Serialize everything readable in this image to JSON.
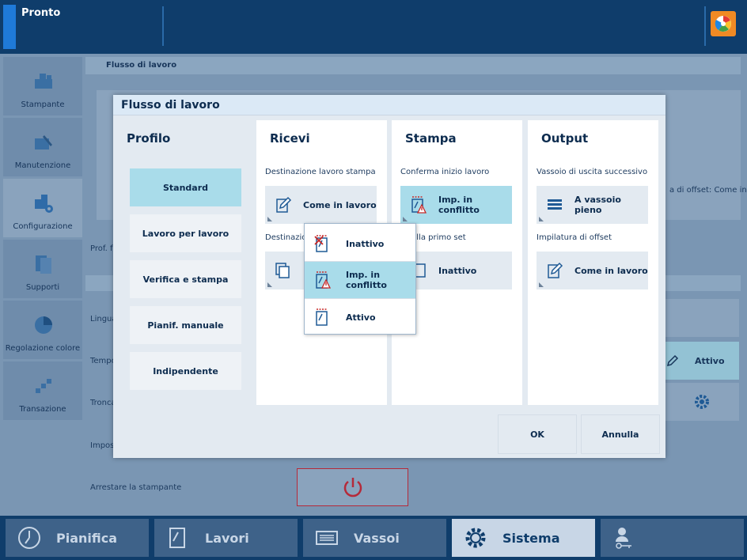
{
  "status": {
    "text": "Pronto"
  },
  "colors": {
    "accent": "#1f7ad8",
    "highlight": "#a9dcea",
    "stop": "#b52a3a"
  },
  "left_nav": [
    {
      "label": "Stampante",
      "icon": "printer-icon"
    },
    {
      "label": "Manutenzione",
      "icon": "maintenance-icon"
    },
    {
      "label": "Configurazione",
      "icon": "configuration-icon"
    },
    {
      "label": "Supporti",
      "icon": "media-icon"
    },
    {
      "label": "Regolazione colore",
      "icon": "color-adjust-icon"
    },
    {
      "label": "Transazione",
      "icon": "transaction-icon"
    }
  ],
  "background": {
    "section_title": "Flusso di lavoro",
    "prof_label": "Prof. f",
    "offset_text": "a di offset: Come in",
    "rows": [
      "Lingua",
      "Tempo",
      "Tronca",
      "Impost",
      "Arrestare la stampante"
    ],
    "attivo_label": "Attivo"
  },
  "dialog": {
    "title": "Flusso di lavoro",
    "profile": {
      "heading": "Profilo",
      "options": [
        "Standard",
        "Lavoro per lavoro",
        "Verifica e stampa",
        "Pianif. manuale",
        "Indipendente"
      ],
      "selected": "Standard"
    },
    "ricevi": {
      "heading": "Ricevi",
      "field1_label": "Destinazione lavoro stampa",
      "field1_value": "Come in lavoro",
      "field2_label": "Destinazio"
    },
    "stampa": {
      "heading": "Stampa",
      "field1_label": "Conferma inizio lavoro",
      "field1_value_line1": "Imp. in",
      "field1_value_line2": "conflitto",
      "field2_label": "ntrolla primo set",
      "field2_value": "Inattivo"
    },
    "output": {
      "heading": "Output",
      "field1_label": "Vassoio di uscita successivo",
      "field1_value_line1": "A vassoio",
      "field1_value_line2": "pieno",
      "field2_label": "Impilatura di offset",
      "field2_value": "Come in lavoro"
    },
    "ok_label": "OK",
    "cancel_label": "Annulla"
  },
  "popup": {
    "items": [
      {
        "line1": "Inattivo",
        "line2": "",
        "icon": "inactive-sheet-icon"
      },
      {
        "line1": "Imp. in",
        "line2": "conflitto",
        "icon": "conflict-sheet-icon"
      },
      {
        "line1": "Attivo",
        "line2": "",
        "icon": "active-sheet-icon"
      }
    ],
    "selected_index": 1
  },
  "bottom_nav": [
    {
      "label": "Pianifica",
      "icon": "clock-icon"
    },
    {
      "label": "Lavori",
      "icon": "jobs-icon"
    },
    {
      "label": "Vassoi",
      "icon": "trays-icon"
    },
    {
      "label": "Sistema",
      "icon": "gear-icon"
    },
    {
      "label": "",
      "icon": "user-key-icon"
    }
  ]
}
